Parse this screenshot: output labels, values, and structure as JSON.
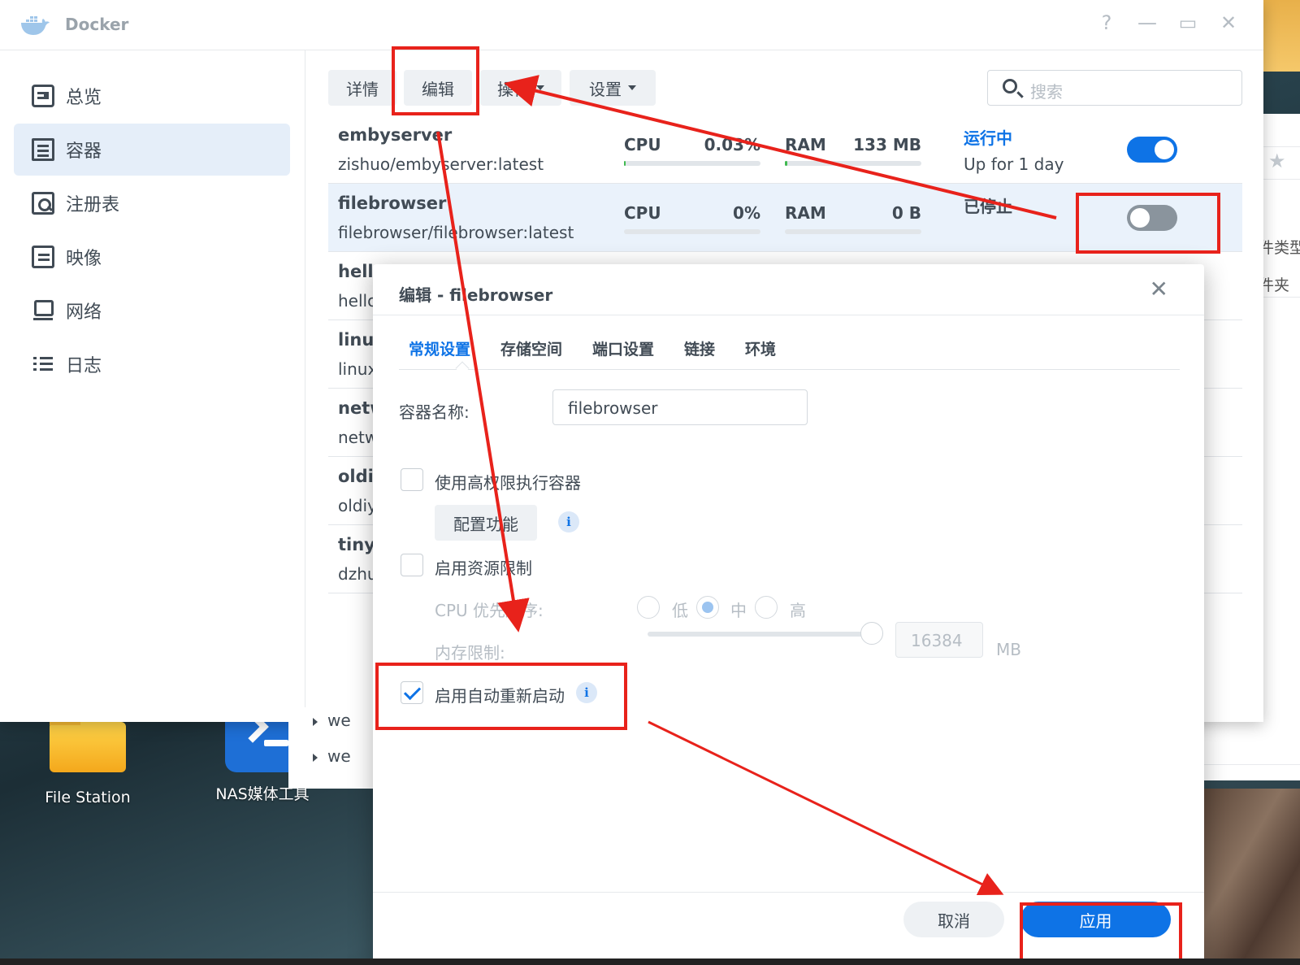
{
  "app": {
    "title": "Docker",
    "window_controls": [
      "?",
      "—",
      "▭",
      "✕"
    ]
  },
  "sidebar": {
    "items": [
      {
        "label": "总览",
        "icon": "overview-icon"
      },
      {
        "label": "容器",
        "icon": "container-icon",
        "active": true
      },
      {
        "label": "注册表",
        "icon": "registry-icon"
      },
      {
        "label": "映像",
        "icon": "image-icon"
      },
      {
        "label": "网络",
        "icon": "network-icon"
      },
      {
        "label": "日志",
        "icon": "log-icon"
      }
    ]
  },
  "toolbar": {
    "details": "详情",
    "edit": "编辑",
    "action": "操作",
    "settings": "设置",
    "search_placeholder": "搜索"
  },
  "containers": [
    {
      "name": "embyserver",
      "image": "zishuo/embyserver:latest",
      "cpu_label": "CPU",
      "cpu": "0.03%",
      "ram_label": "RAM",
      "ram": "133 MB",
      "status": "运行中",
      "uptime": "Up for 1 day",
      "running": true
    },
    {
      "name": "filebrowser",
      "image": "filebrowser/filebrowser:latest",
      "cpu_label": "CPU",
      "cpu": "0%",
      "ram_label": "RAM",
      "ram": "0 B",
      "status": "已停止",
      "uptime": "",
      "running": false
    },
    {
      "name": "hell",
      "image": "hello"
    },
    {
      "name": "linu",
      "image": "linux"
    },
    {
      "name": "netw",
      "image": "netw"
    },
    {
      "name": "oldi",
      "image": "oldiy"
    },
    {
      "name": "tiny",
      "image": "dzhu"
    }
  ],
  "tree_items": [
    "we",
    "we"
  ],
  "dialog": {
    "title": "编辑 - filebrowser",
    "tabs": [
      "常规设置",
      "存储空间",
      "端口设置",
      "链接",
      "环境"
    ],
    "container_name_label": "容器名称:",
    "container_name_value": "filebrowser",
    "privileged_label": "使用高权限执行容器",
    "config_button": "配置功能",
    "resource_limit_label": "启用资源限制",
    "cpu_priority_label": "CPU 优先顺序:",
    "cpu_priority_options": [
      "低",
      "中",
      "高"
    ],
    "cpu_priority_selected": "中",
    "memory_limit_label": "内存限制:",
    "memory_value": "16384",
    "memory_unit": "MB",
    "auto_restart_label": "启用自动重新启动",
    "auto_restart_checked": true,
    "cancel": "取消",
    "apply": "应用"
  },
  "desktop": {
    "icons": [
      {
        "label": "File Station",
        "icon": "folder-icon"
      },
      {
        "label": "NAS媒体工具",
        "icon": "terminal-icon"
      }
    ]
  },
  "background_window": {
    "labels": [
      "件类型",
      "件夹"
    ]
  },
  "colors": {
    "accent": "#0e73e6",
    "annotation": "#e8221b",
    "text": "#414b55"
  }
}
